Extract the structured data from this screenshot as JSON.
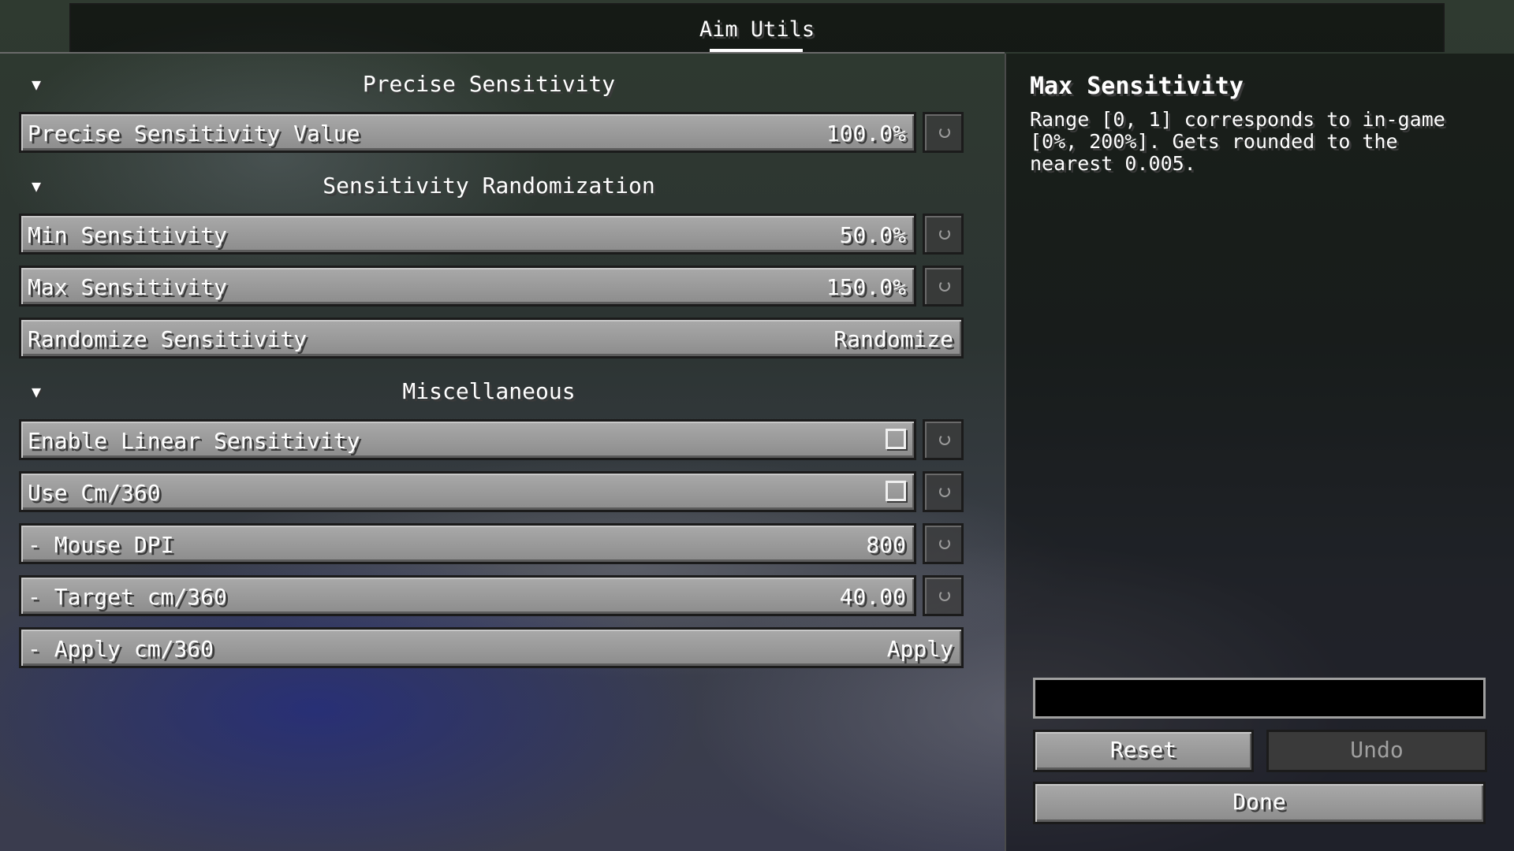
{
  "tab": {
    "label": "Aim Utils"
  },
  "sections": {
    "precise": {
      "title": "Precise Sensitivity"
    },
    "randomization": {
      "title": "Sensitivity Randomization"
    },
    "misc": {
      "title": "Miscellaneous"
    }
  },
  "rows": {
    "precise_value": {
      "label": "Precise Sensitivity Value",
      "value": "100.0%"
    },
    "min_sens": {
      "label": "Min Sensitivity",
      "value": "50.0%"
    },
    "max_sens": {
      "label": "Max Sensitivity",
      "value": "150.0%"
    },
    "randomize": {
      "label": "Randomize Sensitivity",
      "value": "Randomize"
    },
    "linear": {
      "label": "Enable Linear Sensitivity",
      "checked": false
    },
    "cm360": {
      "label": "Use Cm/360",
      "checked": false
    },
    "dpi": {
      "label": "- Mouse DPI",
      "value": "800"
    },
    "target": {
      "label": "- Target cm/360",
      "value": "40.00"
    },
    "apply": {
      "label": "- Apply cm/360",
      "value": "Apply"
    }
  },
  "info": {
    "title": "Max Sensitivity",
    "description": "Range [0, 1] corresponds to in-game\n[0%, 200%]. Gets rounded to the\nnearest 0.005."
  },
  "field": {
    "value": ""
  },
  "buttons": {
    "reset": "Reset",
    "undo": "Undo",
    "done": "Done"
  },
  "icons": {
    "collapse": "triangle-down-icon",
    "reset": "reset-arrow-icon"
  }
}
